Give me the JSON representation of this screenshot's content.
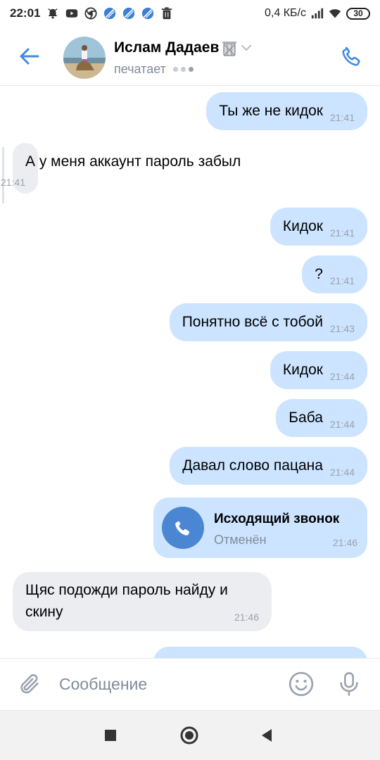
{
  "status_bar": {
    "time": "22:01",
    "speed": "0,4 КБ/с",
    "battery": "30",
    "icons": [
      "alarm-icon",
      "youtube-icon",
      "chrome-icon",
      "blocked-icon",
      "blocked-icon",
      "blocked-icon",
      "trash-icon",
      "signal-icon",
      "wifi-icon",
      "battery-icon"
    ]
  },
  "header": {
    "contact_name": "Ислам Дадаев",
    "status": "печатает",
    "accent_color": "#3f8ae0"
  },
  "messages": [
    {
      "direction": "out",
      "text": "Ты же не кидок",
      "time": "21:41"
    },
    {
      "direction": "in",
      "text": "А у меня аккаунт пароль забыл",
      "time": "21:41"
    },
    {
      "direction": "out",
      "text": "Кидок",
      "time": "21:41"
    },
    {
      "direction": "out",
      "text": "?",
      "time": "21:41"
    },
    {
      "direction": "out",
      "text": "Понятно всё с тобой",
      "time": "21:43"
    },
    {
      "direction": "out",
      "text": "Кидок",
      "time": "21:44"
    },
    {
      "direction": "out",
      "text": "Баба",
      "time": "21:44"
    },
    {
      "direction": "out",
      "text": "Давал слово пацана",
      "time": "21:44"
    },
    {
      "direction": "out",
      "type": "call",
      "title": "Исходящий звонок",
      "subtitle": "Отменён",
      "time": "21:46"
    },
    {
      "direction": "in",
      "text": "Щяс подожди пароль найду и скину",
      "time": "21:46"
    }
  ],
  "composer": {
    "placeholder": "Сообщение"
  },
  "colors": {
    "outgoing_bubble": "#cce4ff",
    "incoming_bubble": "#ebedf0",
    "call_icon_bg": "#4a86d2"
  }
}
